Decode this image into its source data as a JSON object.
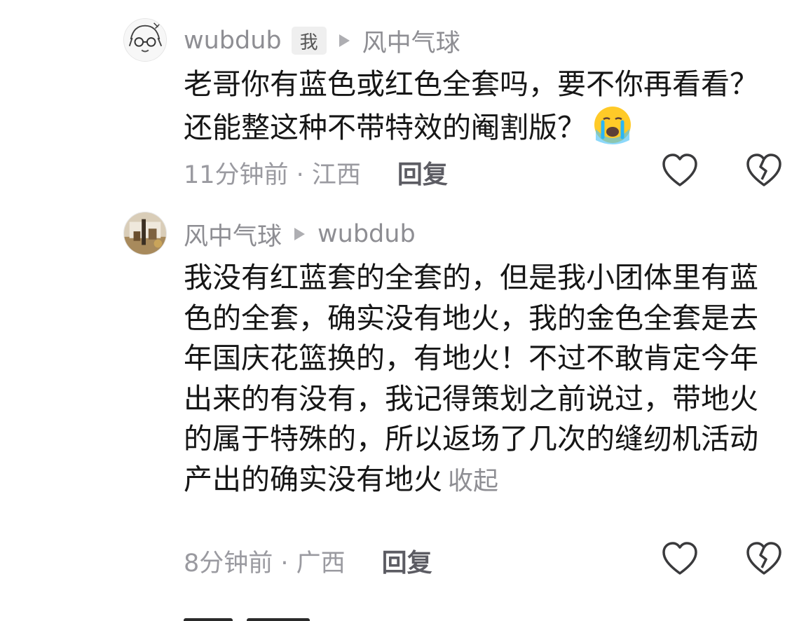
{
  "comments": [
    {
      "author": "wubdub",
      "badge": "我",
      "reply_to": "风中气球",
      "text": "老哥你有蓝色或红色全套吗，要不你再看看？还能整这种不带特效的阉割版？",
      "emoji": "crying-face-icon",
      "time": "11分钟前 · 江西",
      "reply_label": "回复"
    },
    {
      "author": "风中气球",
      "reply_to": "wubdub",
      "text": "我没有红蓝套的全套的，但是我小团体里有蓝色的全套，确实没有地火，我的金色全套是去年国庆花篮换的，有地火！不过不敢肯定今年出来的有没有，我记得策划之前说过，带地火的属于特殊的，所以返场了几次的缝纫机活动产出的确实没有地火",
      "collapse_label": "收起",
      "time": "8分钟前 · 广西",
      "reply_label": "回复"
    }
  ],
  "colors": {
    "text": "#161616",
    "meta": "#8e8e93",
    "reply": "#5c5c63",
    "badge_bg": "#efefef"
  }
}
